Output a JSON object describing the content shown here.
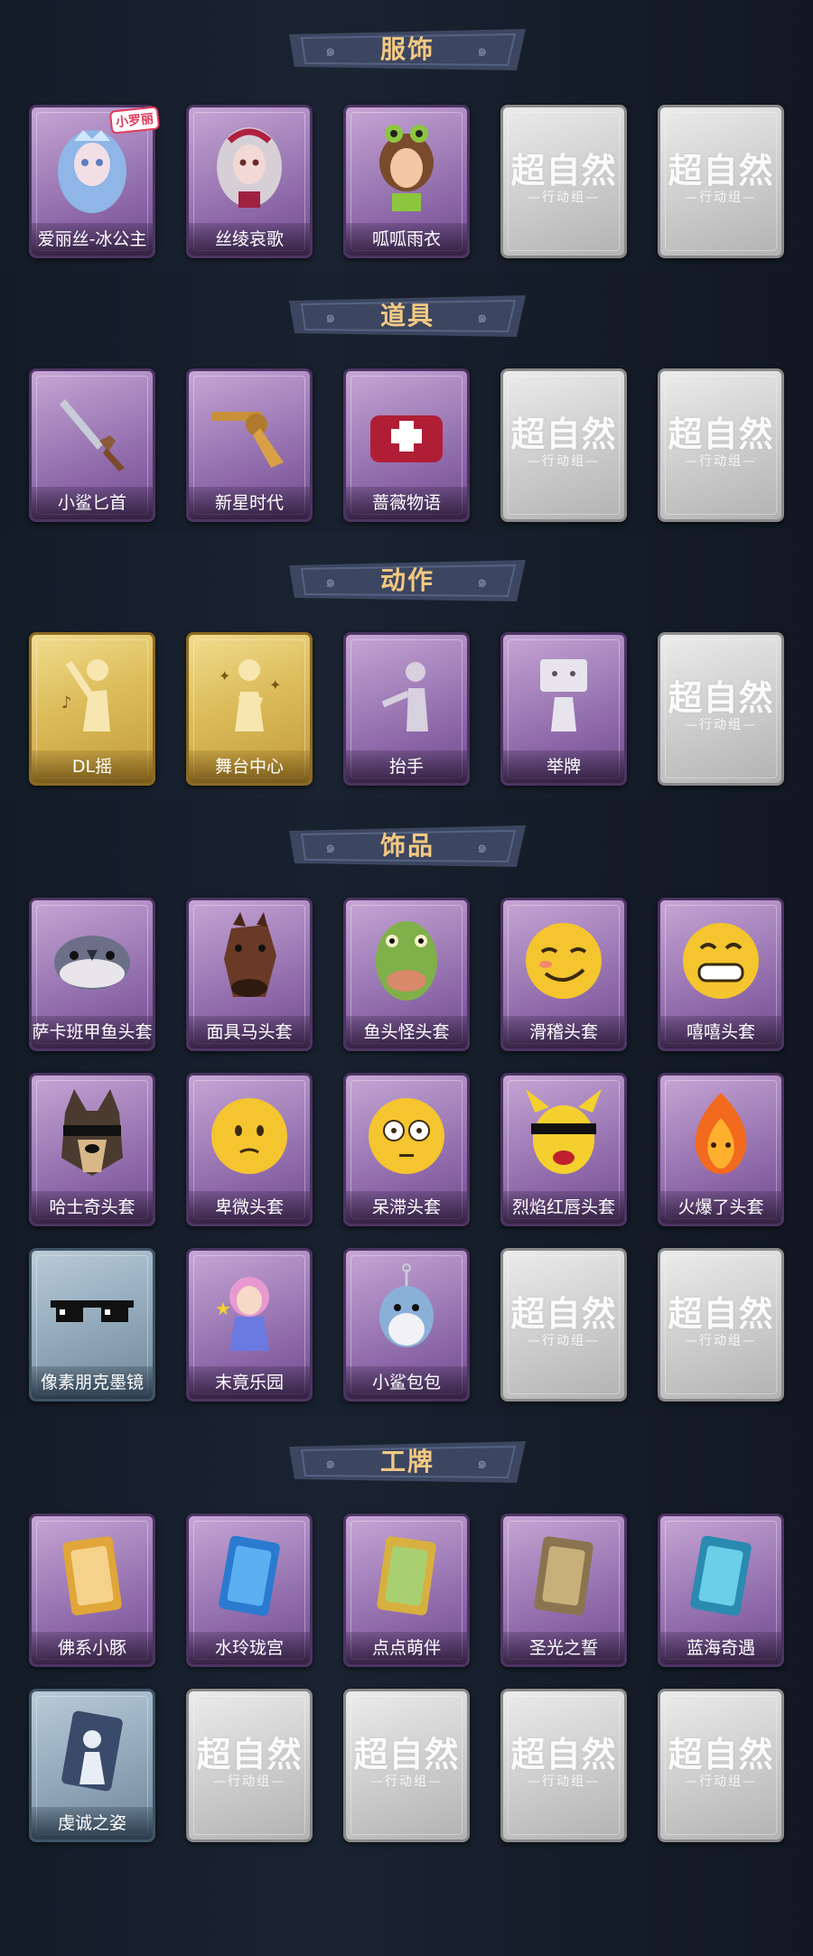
{
  "sections": [
    {
      "title": "服饰",
      "rows": [
        [
          {
            "label": "爱丽丝-冰公主",
            "style": "purple",
            "icon": "ice-princess-portrait-icon",
            "badge": "小罗丽"
          },
          {
            "label": "丝绫哀歌",
            "style": "purple",
            "icon": "doll-portrait-icon"
          },
          {
            "label": "呱呱雨衣",
            "style": "purple",
            "icon": "frog-raincoat-portrait-icon"
          },
          {
            "style": "empty"
          },
          {
            "style": "empty"
          }
        ]
      ]
    },
    {
      "title": "道具",
      "rows": [
        [
          {
            "label": "小鲨匕首",
            "style": "purple",
            "icon": "shark-dagger-icon"
          },
          {
            "label": "新星时代",
            "style": "purple",
            "icon": "revolver-icon"
          },
          {
            "label": "蔷薇物语",
            "style": "purple",
            "icon": "medkit-icon"
          },
          {
            "style": "empty"
          },
          {
            "style": "empty"
          }
        ]
      ]
    },
    {
      "title": "动作",
      "rows": [
        [
          {
            "label": "DL摇",
            "style": "gold",
            "icon": "dance-pose-icon"
          },
          {
            "label": "舞台中心",
            "style": "gold",
            "icon": "stage-pose-icon"
          },
          {
            "label": "抬手",
            "style": "purple",
            "icon": "raise-hand-icon"
          },
          {
            "label": "举牌",
            "style": "purple",
            "icon": "hold-sign-icon"
          },
          {
            "style": "empty"
          }
        ]
      ]
    },
    {
      "title": "饰品",
      "rows": [
        [
          {
            "label": "萨卡班甲鱼头套",
            "style": "purple",
            "icon": "fish-head-icon"
          },
          {
            "label": "面具马头套",
            "style": "purple",
            "icon": "horse-head-icon"
          },
          {
            "label": "鱼头怪头套",
            "style": "purple",
            "icon": "fishman-head-icon"
          },
          {
            "label": "滑稽头套",
            "style": "purple",
            "icon": "smirk-emoji-icon"
          },
          {
            "label": "嘻嘻头套",
            "style": "purple",
            "icon": "grin-emoji-icon"
          }
        ],
        [
          {
            "label": "哈士奇头套",
            "style": "purple",
            "icon": "husky-head-icon"
          },
          {
            "label": "卑微头套",
            "style": "purple",
            "icon": "humble-emoji-icon"
          },
          {
            "label": "呆滞头套",
            "style": "purple",
            "icon": "dazed-emoji-icon"
          },
          {
            "label": "烈焰红唇头套",
            "style": "purple",
            "icon": "pikachu-head-icon"
          },
          {
            "label": "火爆了头套",
            "style": "purple",
            "icon": "fire-spirit-icon"
          }
        ],
        [
          {
            "label": "像素朋克墨镜",
            "style": "blue",
            "icon": "pixel-sunglasses-icon"
          },
          {
            "label": "末竟乐园",
            "style": "purple",
            "icon": "clown-girl-charm-icon"
          },
          {
            "label": "小鲨包包",
            "style": "purple",
            "icon": "shark-bag-icon"
          },
          {
            "style": "empty"
          },
          {
            "style": "empty"
          }
        ]
      ]
    },
    {
      "title": "工牌",
      "rows": [
        [
          {
            "label": "佛系小豚",
            "style": "purple",
            "icon": "golden-card-icon"
          },
          {
            "label": "水玲珑宫",
            "style": "purple",
            "icon": "water-palace-card-icon"
          },
          {
            "label": "点点萌伴",
            "style": "purple",
            "icon": "meadow-card-icon"
          },
          {
            "label": "圣光之誓",
            "style": "purple",
            "icon": "holy-light-card-icon"
          },
          {
            "label": "蓝海奇遇",
            "style": "purple",
            "icon": "blue-sea-card-icon"
          }
        ],
        [
          {
            "label": "虔诚之姿",
            "style": "blue",
            "icon": "devout-pose-card-icon"
          },
          {
            "style": "empty"
          },
          {
            "style": "empty"
          },
          {
            "style": "empty"
          },
          {
            "style": "empty"
          }
        ]
      ]
    }
  ],
  "placeholder": {
    "main": "超自然",
    "sub": "—行动组—"
  },
  "colors": {
    "background": "#0f1621",
    "banner_text": "#f3c982",
    "banner_fill": "#3c4660",
    "purple_card": "#a785bd",
    "gold_card": "#dcbc5a",
    "blue_card": "#93aabb",
    "empty_card": "#cfcfcf"
  }
}
